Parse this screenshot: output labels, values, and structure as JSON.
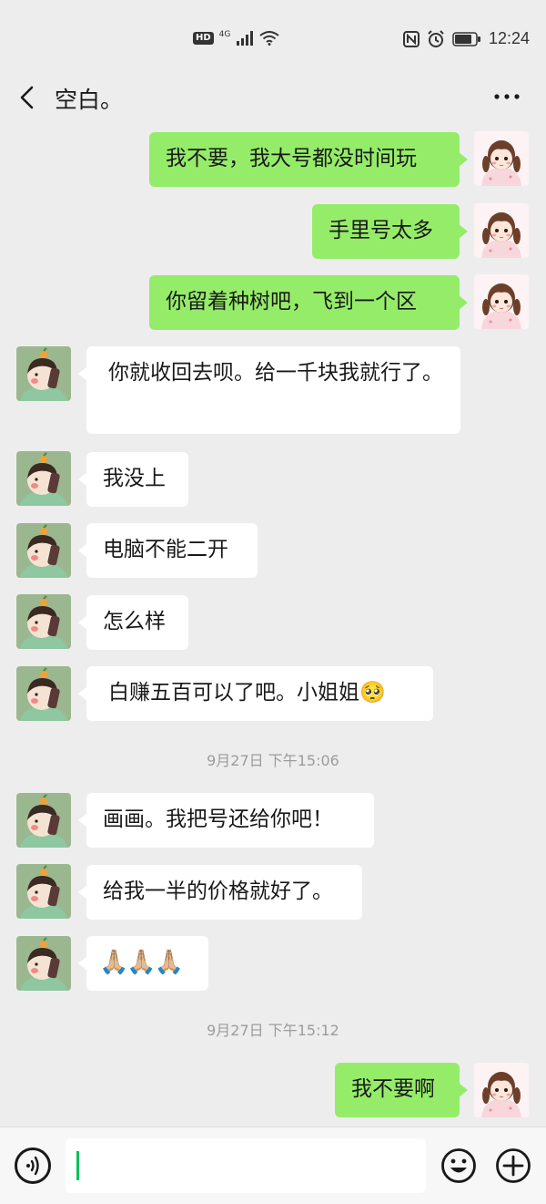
{
  "status_bar": {
    "hd": "HD",
    "network": "4G",
    "time": "12:24",
    "icons": [
      "signal-icon",
      "wifi-icon",
      "nfc-icon",
      "alarm-icon",
      "battery-icon"
    ]
  },
  "header": {
    "title": "空白。",
    "back_icon": "chevron-left-icon",
    "more_icon": "more-dots-icon"
  },
  "messages": [
    {
      "side": "out",
      "text": "我不要，我大号都没时间玩"
    },
    {
      "side": "out",
      "text": "手里号太多"
    },
    {
      "side": "out",
      "text": "你留着种树吧，飞到一个区"
    },
    {
      "side": "in",
      "text": "你就收回去呗。给一千块我就行了。"
    },
    {
      "side": "in",
      "text": "我没上"
    },
    {
      "side": "in",
      "text": "电脑不能二开"
    },
    {
      "side": "in",
      "text": "怎么样"
    },
    {
      "side": "in",
      "text": "白赚五百可以了吧。小姐姐🥺"
    },
    {
      "type": "timestamp",
      "text": "9月27日 下午15:06"
    },
    {
      "side": "in",
      "text": "画画。我把号还给你吧！"
    },
    {
      "side": "in",
      "text": "给我一半的价格就好了。"
    },
    {
      "side": "in",
      "text": "🙏🏼🙏🏼🙏🏼"
    },
    {
      "type": "timestamp",
      "text": "9月27日 下午15:12"
    },
    {
      "side": "out",
      "text": "我不要啊"
    }
  ],
  "input": {
    "value": ""
  },
  "colors": {
    "background": "#ededed",
    "outgoing_bubble": "#95ec69",
    "incoming_bubble": "#ffffff",
    "caret": "#07c160"
  }
}
